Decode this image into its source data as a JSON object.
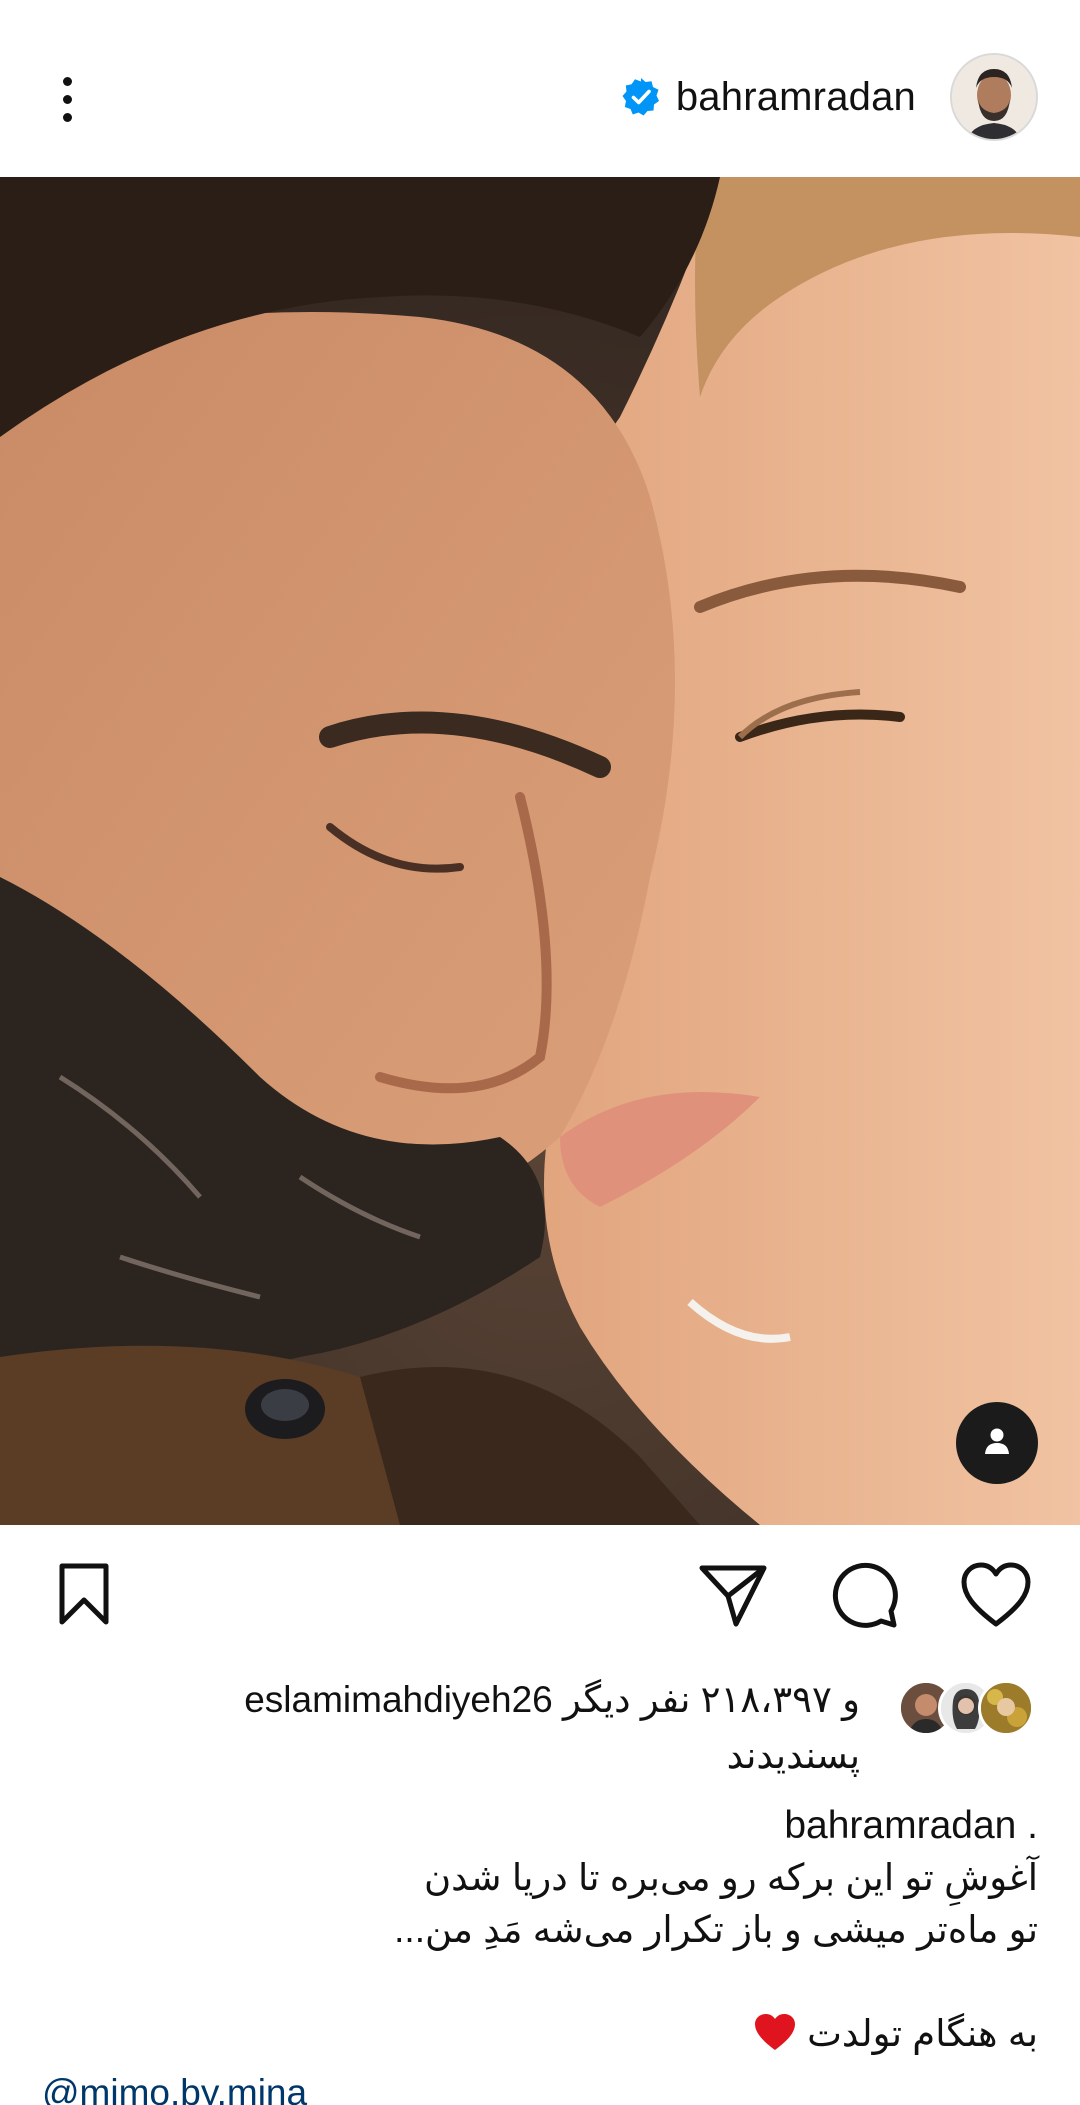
{
  "header": {
    "username": "bahramradan",
    "verified": true,
    "menu_icon": "more-vertical-icon"
  },
  "post": {
    "image_alt": "Close-up portrait of a man and a woman, foreheads touching",
    "tag_icon": "user-tag-icon"
  },
  "actions": {
    "icons": [
      "heart-icon",
      "comment-icon",
      "share-icon",
      "bookmark-icon"
    ]
  },
  "likes": {
    "text_prefix": "و ۲۱۸،۳۹۷ نفر دیگر",
    "liked_by_user": "eslamimahdiyeh26",
    "text_suffix": "پسندیدند"
  },
  "caption": {
    "username": "bahramradan .",
    "line1": "آغوشِ تو این برکه رو می‌بره تا دریا شدن",
    "line2": "تو ماه‌تر میشی و باز تکرار می‌شه مَدِ من...",
    "line3": "به هنگام تولدت",
    "mention": "@mimo.by.mina"
  },
  "colors": {
    "verified_blue": "#0095f6",
    "text": "#111111",
    "mention": "#00376b",
    "heart_red": "#e0141e"
  }
}
